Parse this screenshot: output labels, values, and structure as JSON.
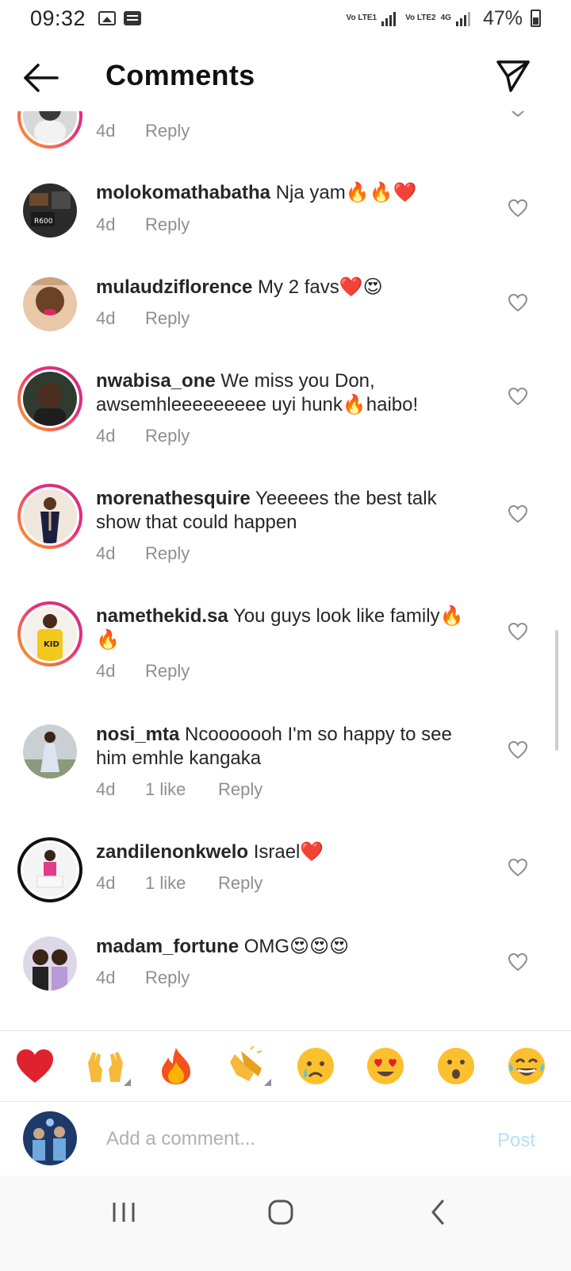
{
  "status_bar": {
    "time": "09:32",
    "net1": "Vo LTE1",
    "net2": "Vo LTE2",
    "net_type": "4G",
    "battery": "47%"
  },
  "header": {
    "title": "Comments"
  },
  "comments": [
    {
      "username": "",
      "text": "",
      "time": "4d",
      "likes": "",
      "reply": "Reply",
      "ring": "story"
    },
    {
      "username": "molokomathabatha",
      "text": "Nja yam🔥🔥❤️",
      "time": "4d",
      "likes": "",
      "reply": "Reply",
      "ring": "none"
    },
    {
      "username": "mulaudziflorence",
      "text": "My 2 favs❤️😍",
      "time": "4d",
      "likes": "",
      "reply": "Reply",
      "ring": "none"
    },
    {
      "username": "nwabisa_one",
      "text": "We miss you Don, awsemhleeeeeeeee uyi hunk🔥haibo!",
      "time": "4d",
      "likes": "",
      "reply": "Reply",
      "ring": "story"
    },
    {
      "username": "morenathesquire",
      "text": "Yeeeees the best talk show that could happen",
      "time": "4d",
      "likes": "",
      "reply": "Reply",
      "ring": "story"
    },
    {
      "username": "namethekid.sa",
      "text": "You guys look like family🔥🔥",
      "time": "4d",
      "likes": "",
      "reply": "Reply",
      "ring": "story"
    },
    {
      "username": "nosi_mta",
      "text": "Ncooooooh I'm so happy to see him emhle kangaka",
      "time": "4d",
      "likes": "1 like",
      "reply": "Reply",
      "ring": "none"
    },
    {
      "username": "zandilenonkwelo",
      "text": "Israel❤️",
      "time": "4d",
      "likes": "1 like",
      "reply": "Reply",
      "ring": "seen"
    },
    {
      "username": "madam_fortune",
      "text": "OMG😍😍😍",
      "time": "4d",
      "likes": "",
      "reply": "Reply",
      "ring": "none"
    }
  ],
  "emoji_bar": {
    "emojis": [
      "❤️",
      "🙌",
      "🔥",
      "👏",
      "😢",
      "😍",
      "😮",
      "😂"
    ]
  },
  "composer": {
    "placeholder": "Add a comment...",
    "post_label": "Post"
  },
  "colors": {
    "accent_disabled": "#b2dffc",
    "story_ring_start": "#f9a825",
    "story_ring_end": "#c13584",
    "muted_text": "#8e8e8e"
  }
}
